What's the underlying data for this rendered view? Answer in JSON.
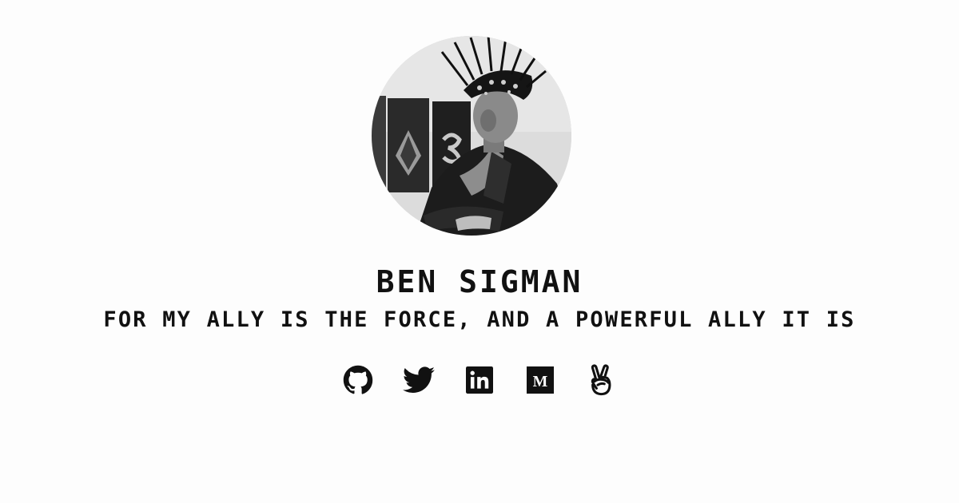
{
  "profile": {
    "name": "BEN SIGMAN",
    "tagline": "FOR MY ALLY IS THE FORCE, AND A POWERFUL ALLY IT IS",
    "avatar_icon": "profile-photo"
  },
  "socials": [
    {
      "id": "github",
      "icon": "github-icon"
    },
    {
      "id": "twitter",
      "icon": "twitter-icon"
    },
    {
      "id": "linkedin",
      "icon": "linkedin-icon"
    },
    {
      "id": "medium",
      "icon": "medium-icon"
    },
    {
      "id": "angellist",
      "icon": "angellist-icon"
    }
  ],
  "colors": {
    "background": "#fdfdfd",
    "text": "#111111"
  }
}
